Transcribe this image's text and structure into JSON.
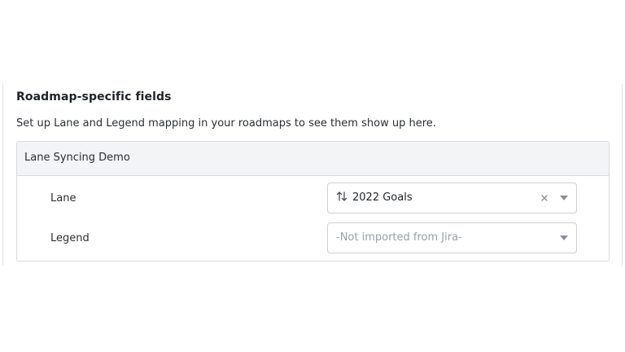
{
  "section": {
    "title": "Roadmap-specific fields",
    "description": "Set up Lane and Legend mapping in your roadmaps to see them show up here."
  },
  "card": {
    "header": "Lane Syncing Demo",
    "rows": [
      {
        "label": "Lane",
        "value": "2022 Goals",
        "placeholder": "",
        "icon": "sort-arrows-icon",
        "clearable": true
      },
      {
        "label": "Legend",
        "value": "",
        "placeholder": "-Not imported from Jira-",
        "icon": "",
        "clearable": false
      }
    ]
  },
  "colors": {
    "header_bg": "#f2f4f6",
    "border": "#d7dadf",
    "placeholder": "#9aa0a6",
    "icon": "#8a9099"
  }
}
